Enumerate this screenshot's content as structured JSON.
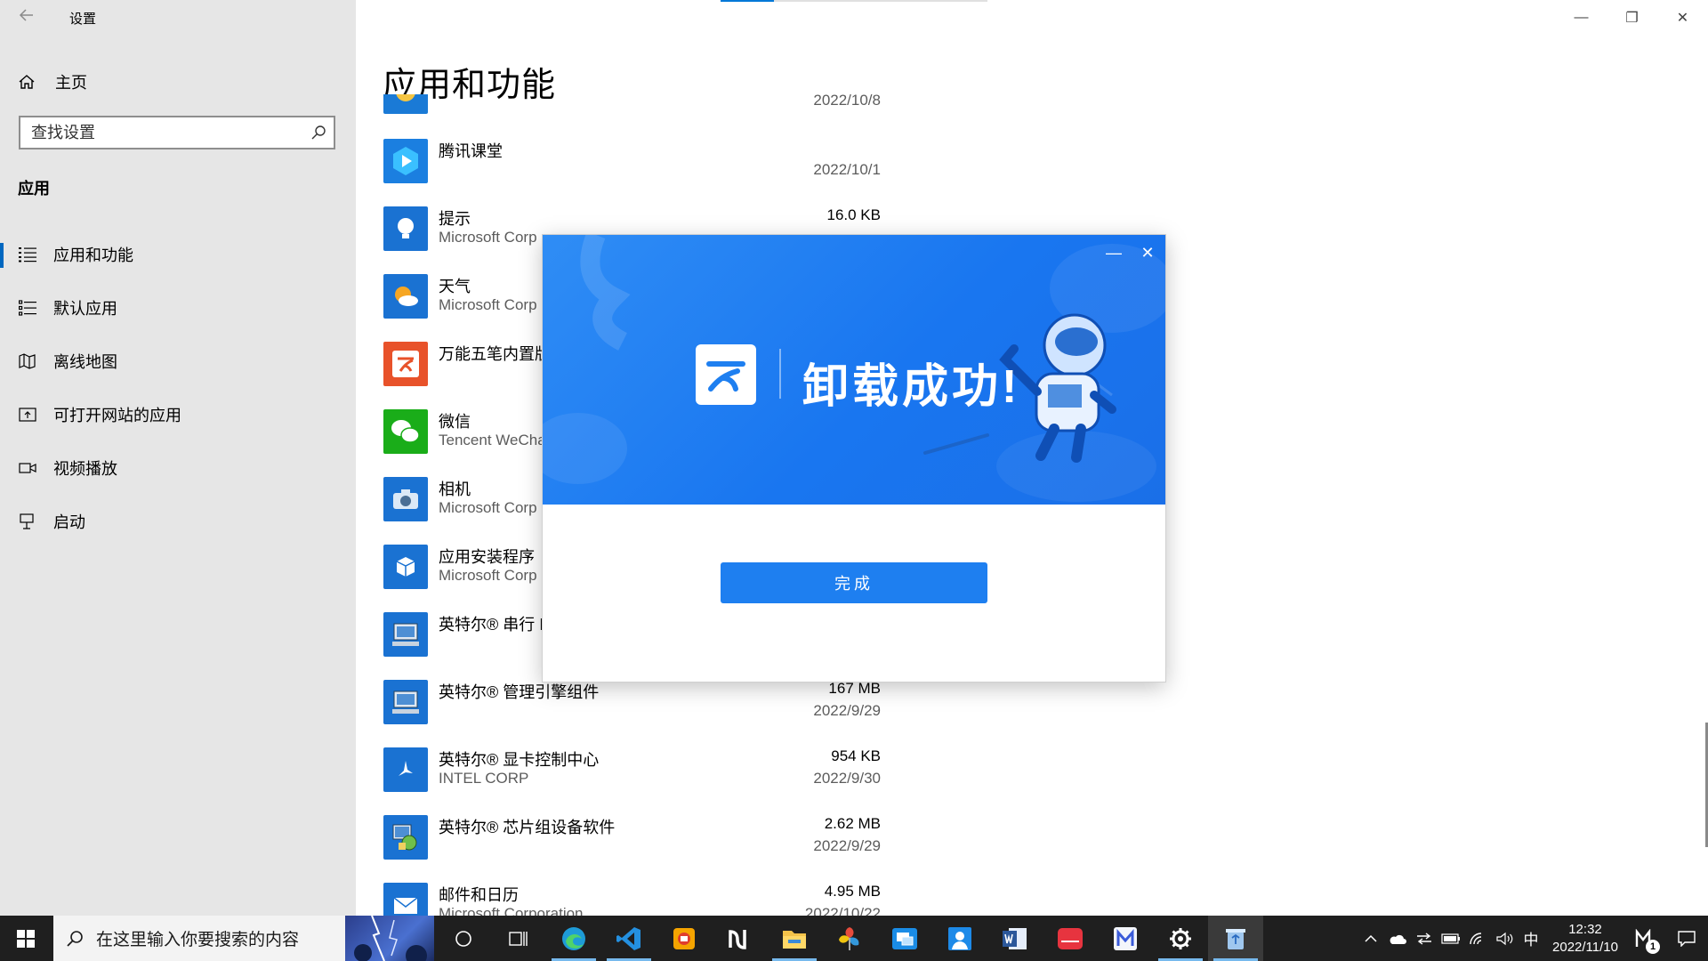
{
  "window": {
    "title": "设置",
    "controls": {
      "minimize": "—",
      "restore": "❐",
      "close": "✕"
    }
  },
  "sidebar": {
    "back_icon": "back-arrow-icon",
    "home_label": "主页",
    "search_placeholder": "查找设置",
    "section_title": "应用",
    "items": [
      {
        "label": "应用和功能",
        "icon": "apps-features-icon",
        "active": true
      },
      {
        "label": "默认应用",
        "icon": "default-apps-icon",
        "active": false
      },
      {
        "label": "离线地图",
        "icon": "offline-maps-icon",
        "active": false
      },
      {
        "label": "可打开网站的应用",
        "icon": "apps-for-websites-icon",
        "active": false
      },
      {
        "label": "视频播放",
        "icon": "video-playback-icon",
        "active": false
      },
      {
        "label": "启动",
        "icon": "startup-icon",
        "active": false
      }
    ]
  },
  "main": {
    "page_title": "应用和功能",
    "apps": [
      {
        "name": "",
        "publisher": "",
        "size": "",
        "date": "2022/10/8"
      },
      {
        "name": "腾讯课堂",
        "publisher": "",
        "size": "",
        "date": "2022/10/1"
      },
      {
        "name": "提示",
        "publisher": "Microsoft Corp",
        "size": "16.0 KB",
        "date": ""
      },
      {
        "name": "天气",
        "publisher": "Microsoft Corp",
        "size": "",
        "date": ""
      },
      {
        "name": "万能五笔内置版",
        "publisher": "",
        "size": "",
        "date": ""
      },
      {
        "name": "微信",
        "publisher": "Tencent WeCha",
        "size": "",
        "date": ""
      },
      {
        "name": "相机",
        "publisher": "Microsoft Corp",
        "size": "",
        "date": ""
      },
      {
        "name": "应用安装程序",
        "publisher": "Microsoft Corp",
        "size": "",
        "date": ""
      },
      {
        "name": "英特尔® 串行 I",
        "publisher": "",
        "size": "",
        "date": ""
      },
      {
        "name": "英特尔® 管理引擎组件",
        "publisher": "",
        "size": "167 MB",
        "date": "2022/9/29"
      },
      {
        "name": "英特尔® 显卡控制中心",
        "publisher": "INTEL CORP",
        "size": "954 KB",
        "date": "2022/9/30"
      },
      {
        "name": "英特尔® 芯片组设备软件",
        "publisher": "",
        "size": "2.62 MB",
        "date": "2022/9/29"
      },
      {
        "name": "邮件和日历",
        "publisher": "Microsoft Corporation",
        "size": "4.95 MB",
        "date": "2022/10/22"
      }
    ]
  },
  "dialog": {
    "banner_text": "卸载成功!",
    "minimize": "—",
    "close": "✕",
    "done_button": "完成",
    "accent_color": "#1e7ff0"
  },
  "taskbar": {
    "search_placeholder": "在这里输入你要搜索的内容",
    "pinned_apps": [
      {
        "name": "task-view-icon"
      },
      {
        "name": "edge-icon"
      },
      {
        "name": "vscode-icon"
      },
      {
        "name": "app-orange-icon"
      },
      {
        "name": "notion-icon"
      },
      {
        "name": "file-explorer-icon"
      },
      {
        "name": "app-pinwheel-icon"
      },
      {
        "name": "remote-desktop-icon"
      },
      {
        "name": "contacts-icon"
      },
      {
        "name": "word-icon"
      },
      {
        "name": "huawei-icon"
      },
      {
        "name": "app-m-icon"
      },
      {
        "name": "settings-icon"
      },
      {
        "name": "recycle-app-icon"
      }
    ],
    "tray": {
      "ime_label": "中",
      "time": "12:32",
      "date": "2022/11/10",
      "badge_count": "1"
    }
  }
}
